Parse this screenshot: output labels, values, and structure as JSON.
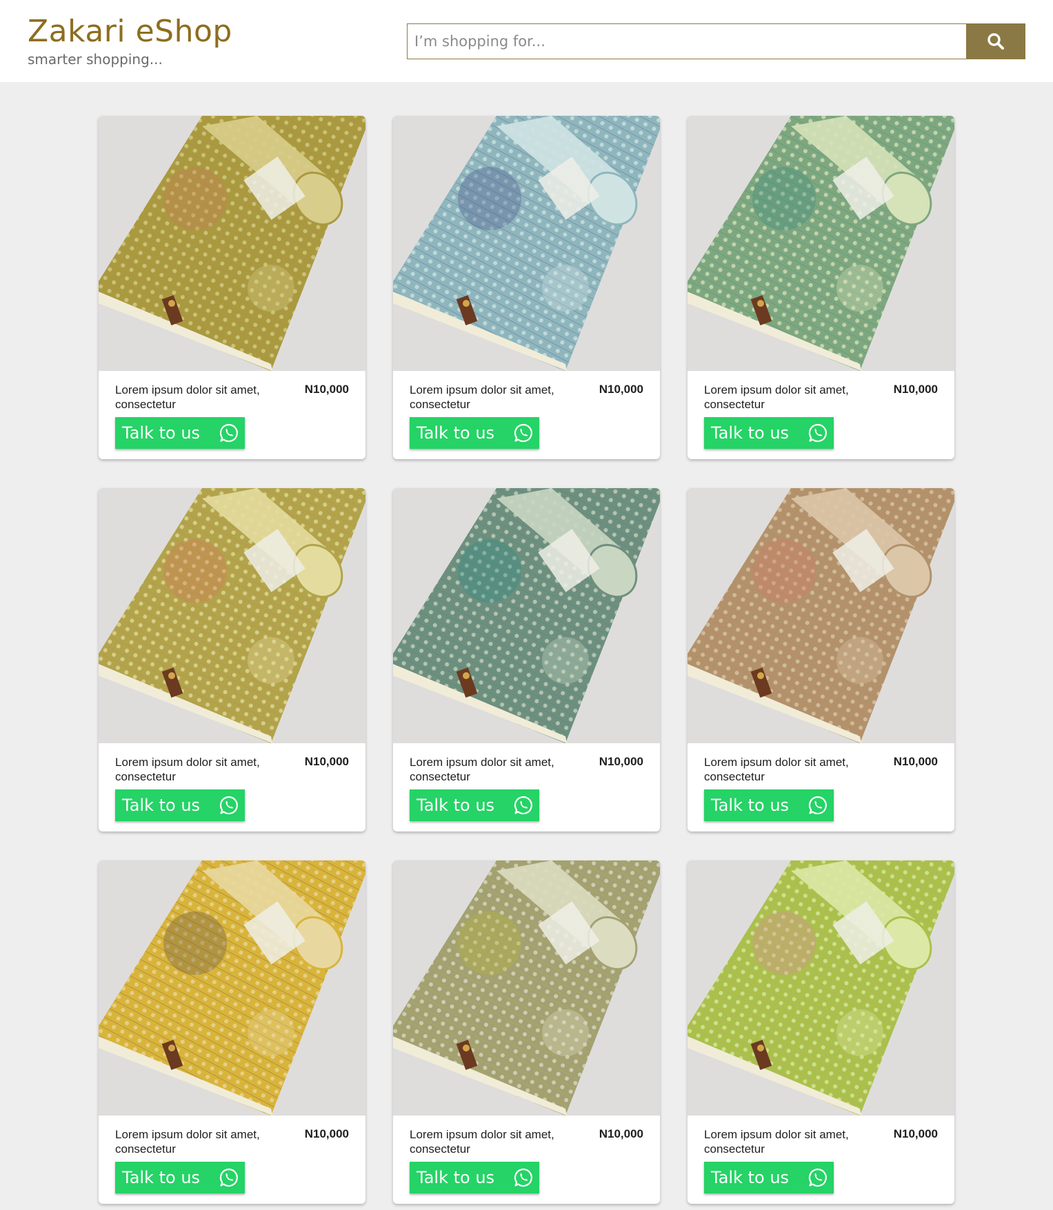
{
  "header": {
    "brand_title": "Zakari eShop",
    "brand_tagline": "smarter shopping...",
    "search_placeholder": "I’m shopping for...",
    "search_icon": "search-icon"
  },
  "colors": {
    "brand": "#8d6e1e",
    "search_button": "#8a7944",
    "whatsapp_green": "#25d366",
    "page_bg": "#efeeef"
  },
  "products": [
    {
      "description": "Lorem ipsum dolor sit amet, consectetur",
      "price": "N10,000",
      "button_label": "Talk to us",
      "icon": "whatsapp-icon",
      "fabric_color": "#a99a3f",
      "roll_color": "#d8cd8a",
      "accent_color": "#c77d55"
    },
    {
      "description": "Lorem ipsum dolor sit amet, consectetur",
      "price": "N10,000",
      "button_label": "Talk to us",
      "icon": "whatsapp-icon",
      "fabric_color": "#8fb6bd",
      "roll_color": "#cfe3e3",
      "accent_color": "#4a5a8c"
    },
    {
      "description": "Lorem ipsum dolor sit amet, consectetur",
      "price": "N10,000",
      "button_label": "Talk to us",
      "icon": "whatsapp-icon",
      "fabric_color": "#7ea780",
      "roll_color": "#d6e2b8",
      "accent_color": "#3e8c7e"
    },
    {
      "description": "Lorem ipsum dolor sit amet, consectetur",
      "price": "N10,000",
      "button_label": "Talk to us",
      "icon": "whatsapp-icon",
      "fabric_color": "#b1a44a",
      "roll_color": "#e4dc9e",
      "accent_color": "#d47a5c"
    },
    {
      "description": "Lorem ipsum dolor sit amet, consectetur",
      "price": "N10,000",
      "button_label": "Talk to us",
      "icon": "whatsapp-icon",
      "fabric_color": "#6f8f7e",
      "roll_color": "#c8d6c2",
      "accent_color": "#2f8b84"
    },
    {
      "description": "Lorem ipsum dolor sit amet, consectetur",
      "price": "N10,000",
      "button_label": "Talk to us",
      "icon": "whatsapp-icon",
      "fabric_color": "#b2926b",
      "roll_color": "#dbc6a8",
      "accent_color": "#d07a6a"
    },
    {
      "description": "Lorem ipsum dolor sit amet, consectetur",
      "price": "N10,000",
      "button_label": "Talk to us",
      "icon": "whatsapp-icon",
      "fabric_color": "#d9b43a",
      "roll_color": "#e8d8a0",
      "accent_color": "#6b5a4a"
    },
    {
      "description": "Lorem ipsum dolor sit amet, consectetur",
      "price": "N10,000",
      "button_label": "Talk to us",
      "icon": "whatsapp-icon",
      "fabric_color": "#a3a173",
      "roll_color": "#dcdcc0",
      "accent_color": "#b5b13a"
    },
    {
      "description": "Lorem ipsum dolor sit amet, consectetur",
      "price": "N10,000",
      "button_label": "Talk to us",
      "icon": "whatsapp-icon",
      "fabric_color": "#a9c14a",
      "roll_color": "#dce8a6",
      "accent_color": "#d9909a"
    }
  ]
}
